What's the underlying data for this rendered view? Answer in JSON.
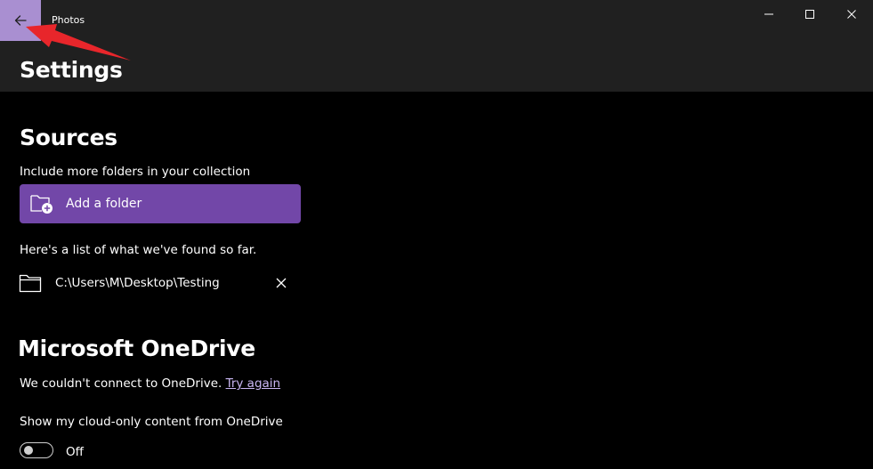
{
  "window": {
    "title": "Photos",
    "controls": {
      "minimize_icon": "minimize-icon",
      "maximize_icon": "maximize-icon",
      "close_icon": "close-icon"
    }
  },
  "header": {
    "back_icon": "back-arrow-icon",
    "page_title": "Settings"
  },
  "sources": {
    "title": "Sources",
    "description": "Include more folders in your collection",
    "add_folder_label": "Add a folder",
    "found_text": "Here's a list of what we've found so far.",
    "folders": [
      {
        "path": "C:\\Users\\M\\Desktop\\Testing"
      }
    ]
  },
  "onedrive": {
    "title": "Microsoft OneDrive",
    "error_text": "We couldn't connect to OneDrive.",
    "try_again_label": "Try again",
    "cloud_label": "Show my cloud-only content from OneDrive",
    "toggle_state": "Off"
  },
  "colors": {
    "accent_button": "#7247a8",
    "back_highlight": "#a98fd1",
    "link": "#c9b6f2",
    "annotation_arrow": "#e8262b"
  }
}
